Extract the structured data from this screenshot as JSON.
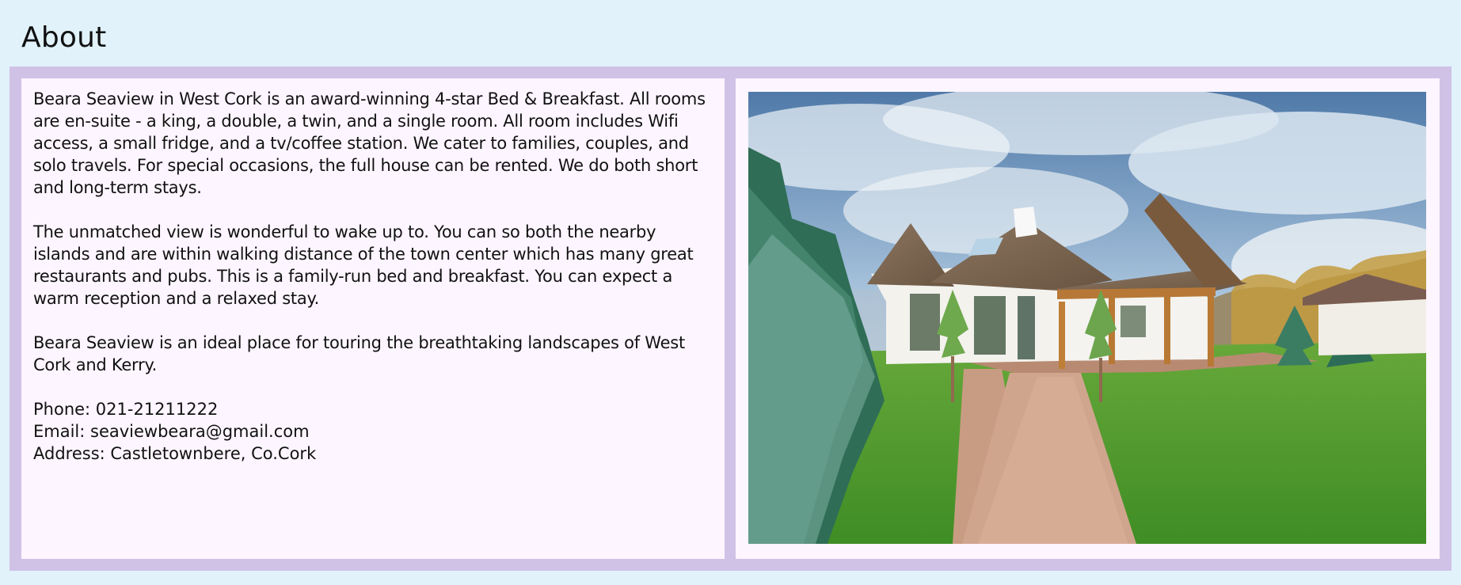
{
  "page": {
    "title": "About"
  },
  "about": {
    "paragraphs": [
      "Beara Seaview in West Cork is an award-winning 4-star Bed & Breakfast. All rooms are en-suite - a king, a double, a twin, and a single room. All room includes Wifi access, a small fridge, and a tv/coffee station. We cater to families, couples, and solo travels. For special occasions, the full house can be rented. We do both short and long-term stays.",
      "The unmatched view is wonderful to wake up to. You can so both the nearby islands and are within walking distance of the town center which has many great restaurants and pubs. This is a family-run bed and breakfast. You can expect a warm reception and a relaxed stay.",
      "Beara Seaview is an ideal place for touring the breathtaking landscapes of West Cork and Kerry."
    ],
    "contact": {
      "phone": "Phone: 021-21211222",
      "email": "Email: seaviewbeara@gmail.com",
      "address": "Address: Castletownbere, Co.Cork"
    }
  },
  "colors": {
    "page_background": "#e1f2fb",
    "frame": "#d0c2e6",
    "panel": "#fdf5ff"
  },
  "image": {
    "icon": "house-photo"
  }
}
